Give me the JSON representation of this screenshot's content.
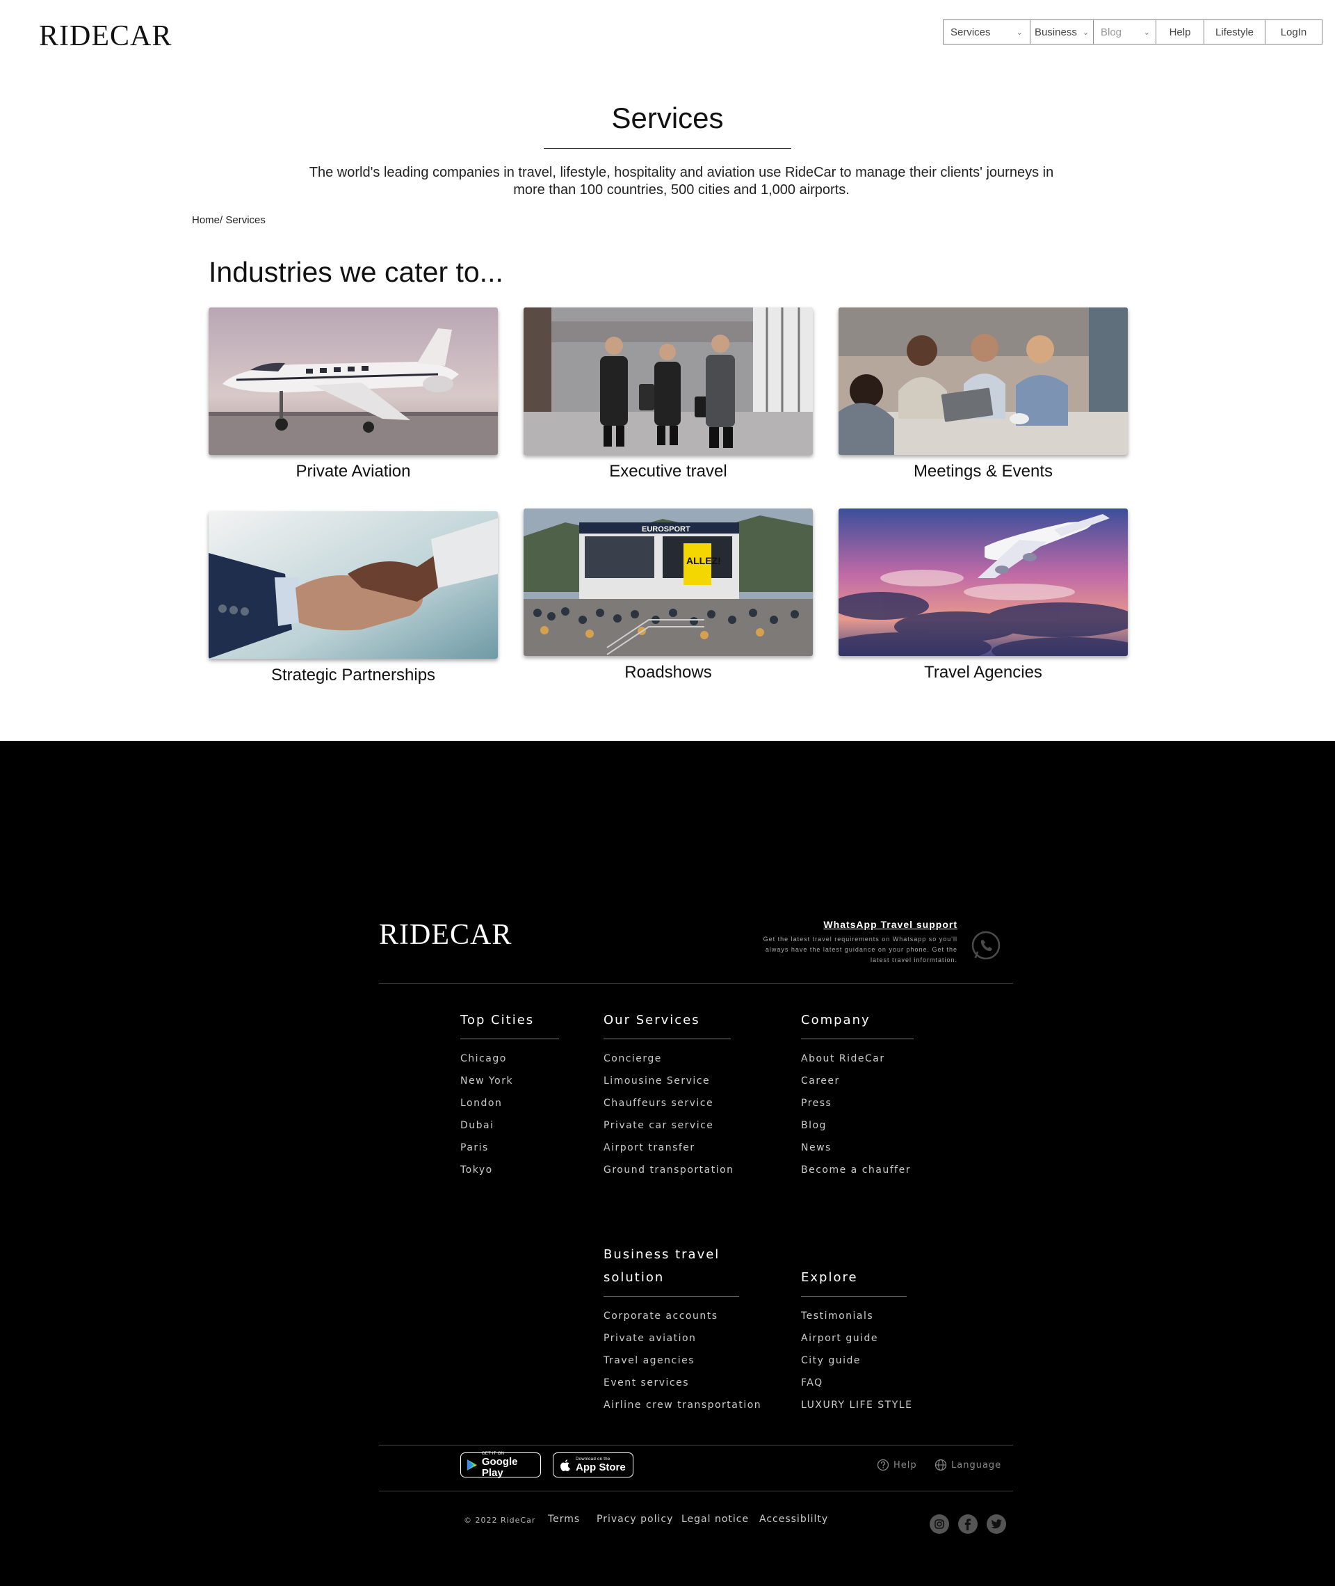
{
  "header": {
    "logo": "RIDECAR",
    "nav": [
      {
        "label": "Services"
      },
      {
        "label": "Business"
      },
      {
        "label": "Blog"
      },
      {
        "label": "Help"
      },
      {
        "label": "Lifestyle"
      },
      {
        "label": "LogIn"
      }
    ]
  },
  "hero": {
    "title": "Services",
    "intro": "The world's leading companies in travel, lifestyle, hospitality and aviation use RideCar to manage their clients' journeys in more than 100 countries, 500 cities and 1,000 airports.",
    "breadcrumb": "Home/ Services"
  },
  "industries": {
    "title": "Industries we cater to...",
    "cards": [
      {
        "label": "Private Aviation"
      },
      {
        "label": "Executive travel"
      },
      {
        "label": "Meetings & Events"
      },
      {
        "label": "Strategic Partnerships"
      },
      {
        "label": "Roadshows"
      },
      {
        "label": "Travel Agencies"
      }
    ],
    "photo_signage": {
      "roadshows_banner": "EUROSPORT",
      "roadshows_text": "ALLEZ!"
    }
  },
  "footer": {
    "logo": "RIDECAR",
    "whatsapp": {
      "title": "WhatsApp Travel support",
      "text": "Get the latest travel requirements on Whatsapp so you'll always have the latest guidance on your phone. Get the latest travel informtation.",
      "icon": "whatsapp-icon"
    },
    "columns": {
      "top_cities": {
        "title": "Top Cities",
        "links": [
          "Chicago",
          "New York",
          "London",
          "Dubai",
          "Paris",
          "Tokyo"
        ]
      },
      "our_services": {
        "title": "Our Services",
        "links": [
          "Concierge",
          "Limousine Service",
          "Chauffeurs service",
          "Private car service",
          "Airport transfer",
          "Ground transportation"
        ]
      },
      "company": {
        "title": "Company",
        "links": [
          "About RideCar",
          "Career",
          "Press",
          "Blog",
          "News",
          "Become a chauffer"
        ]
      },
      "business": {
        "title_line1": "Business travel",
        "title_line2": "solution",
        "links": [
          "Corporate accounts",
          "Private aviation",
          "Travel agencies",
          "Event services",
          "Airline crew transportation"
        ]
      },
      "explore": {
        "title": "Explore",
        "links": [
          "Testimonials",
          "Airport guide",
          "City guide",
          "FAQ",
          "LUXURY LIFE STYLE"
        ]
      }
    },
    "apps": {
      "google": {
        "small": "GET IT ON",
        "big": "Google Play"
      },
      "apple": {
        "small": "Download on the",
        "big": "App Store"
      }
    },
    "utility": {
      "help": "Help",
      "language": "Language"
    },
    "legal": {
      "copyright": "© 2022 RideCar",
      "terms": "Terms",
      "privacy": "Privacy policy",
      "notice": "Legal notice",
      "accessibility": "Accessiblilty"
    },
    "social": [
      "instagram-icon",
      "facebook-icon",
      "twitter-icon"
    ]
  },
  "colors": {
    "footer_bg": "#000000",
    "accent_text": "#ffffff",
    "muted": "#cccccc"
  }
}
